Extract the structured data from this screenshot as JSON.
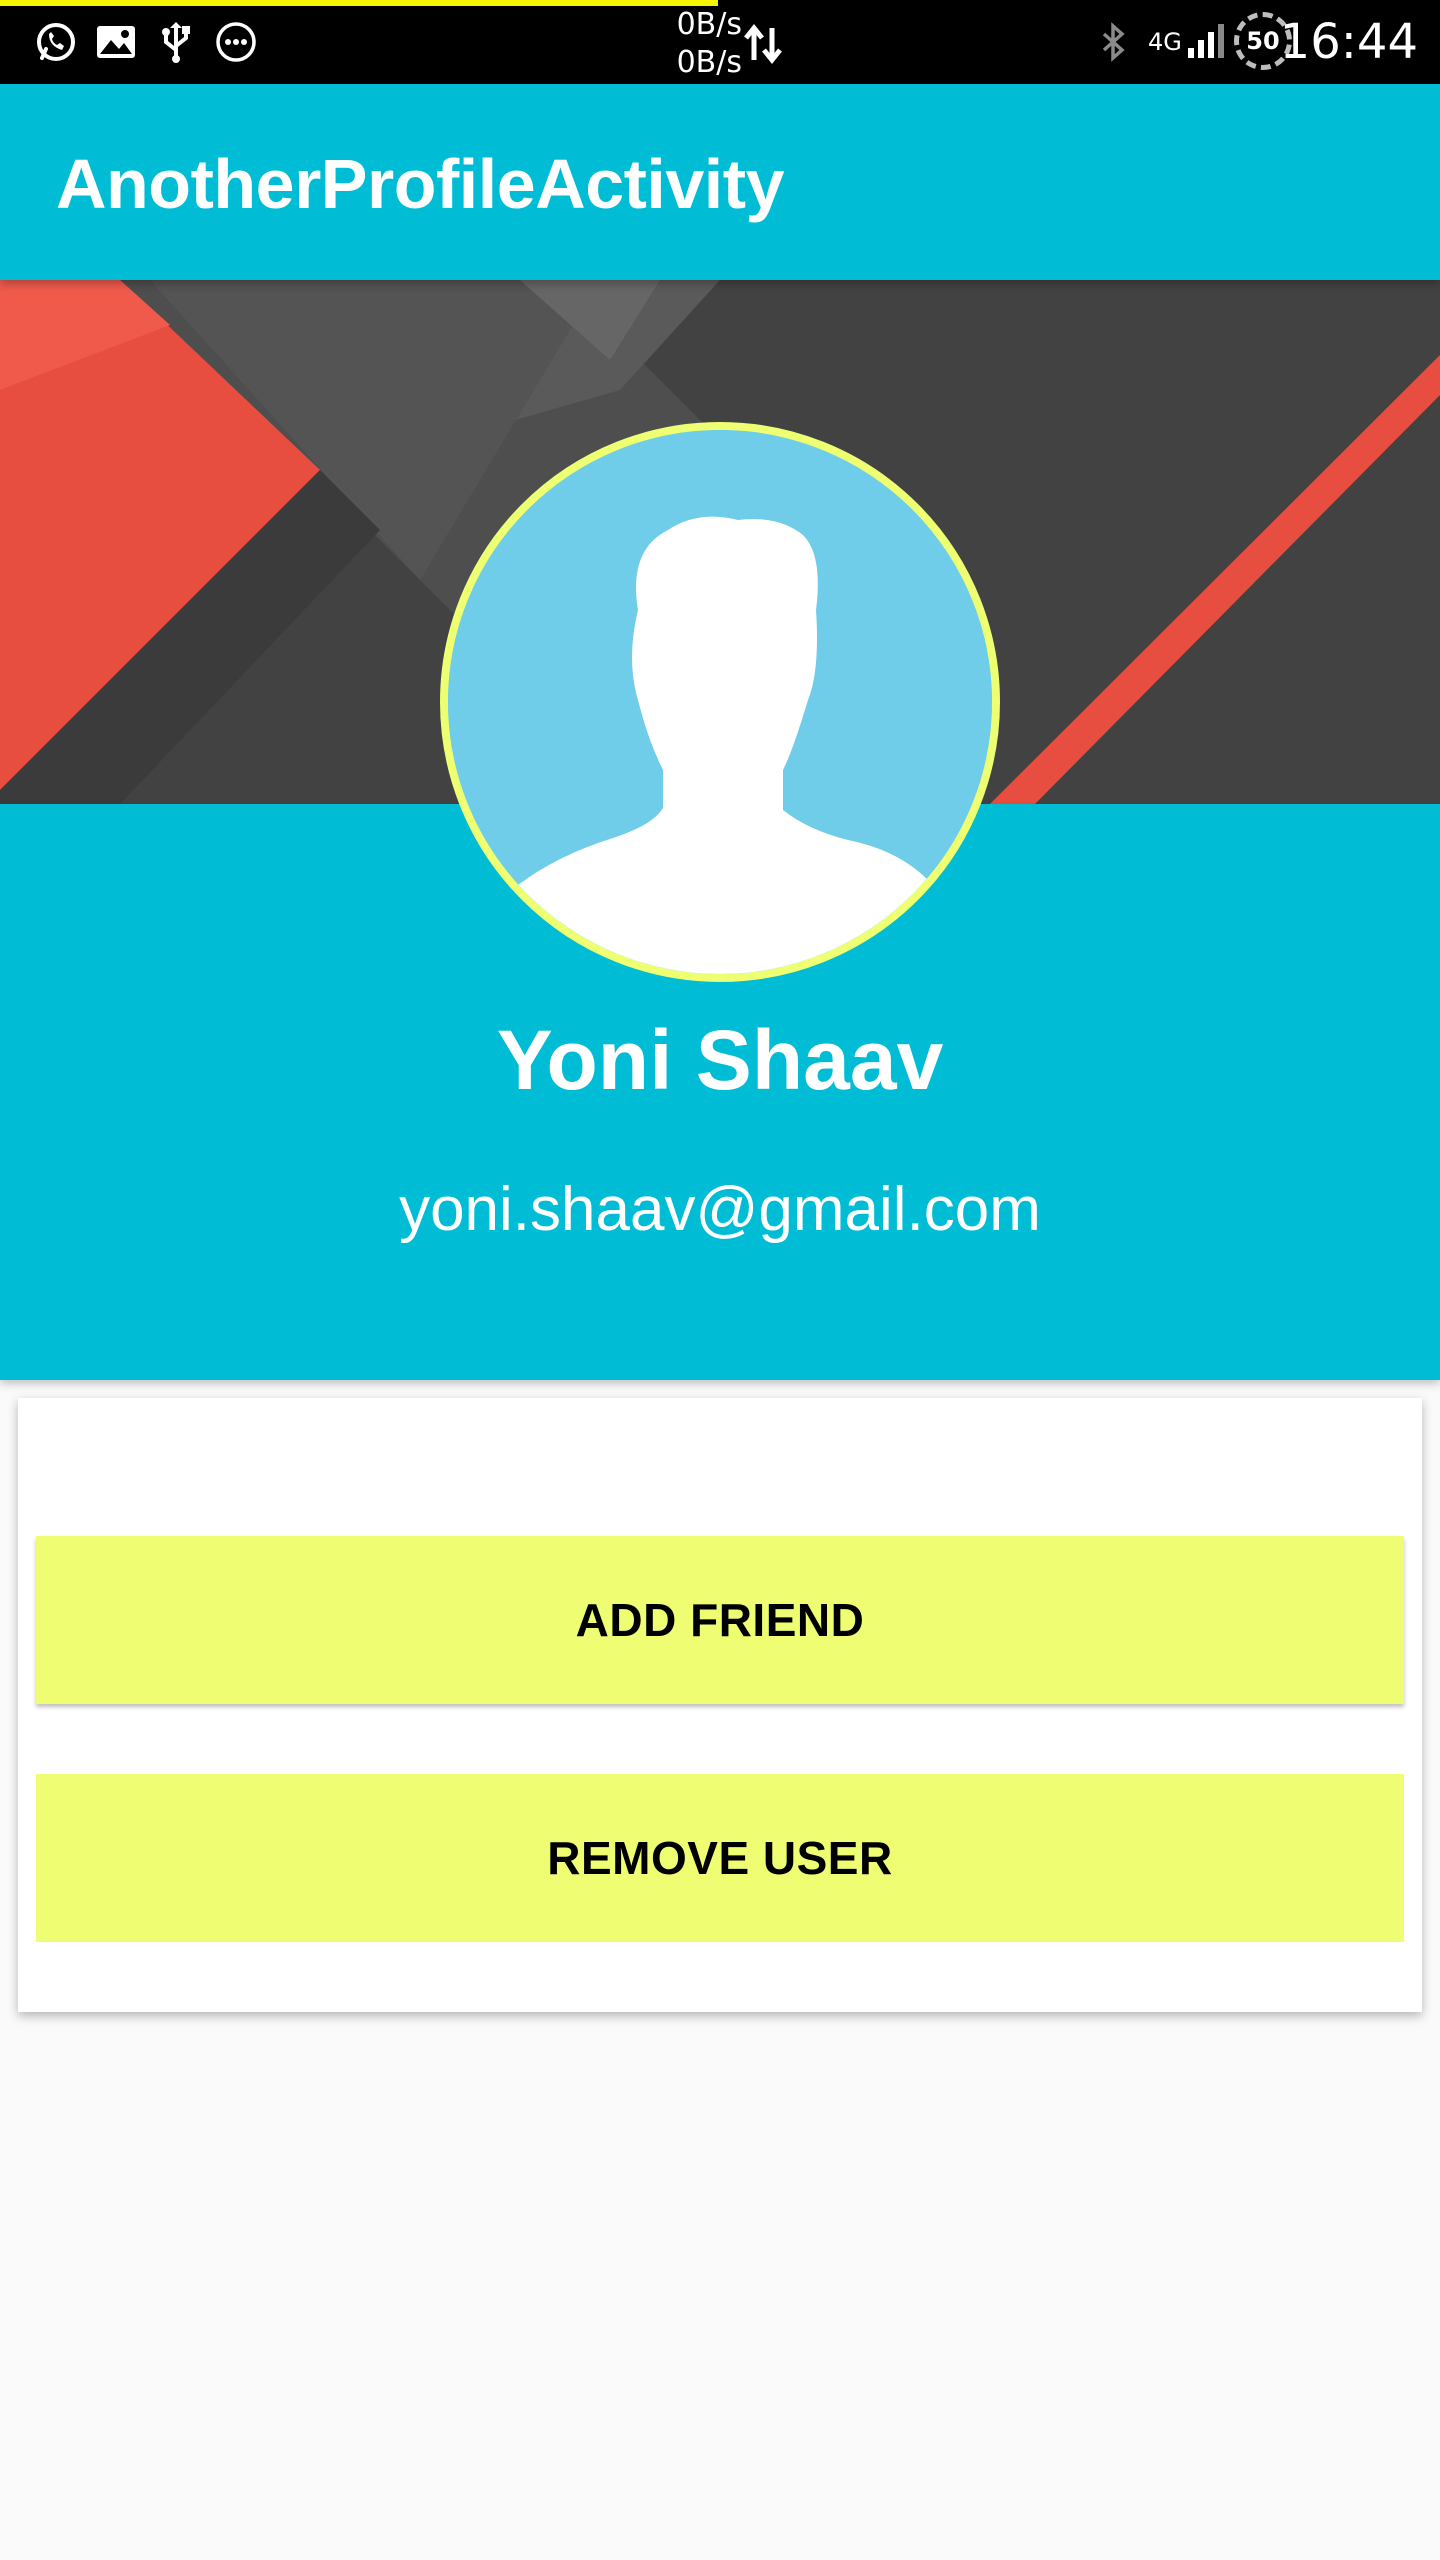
{
  "status_bar": {
    "time": "16:44",
    "upload_speed": "0B/s",
    "download_speed": "0B/s",
    "network_type": "4G",
    "battery_level": "50",
    "notification_icons": [
      "whatsapp-icon",
      "gallery-icon",
      "usb-icon",
      "more-notifications-icon"
    ],
    "system_icons": [
      "data-transfer-icon",
      "bluetooth-icon",
      "signal-icon",
      "battery-icon"
    ]
  },
  "app_bar": {
    "title": "AnotherProfileActivity"
  },
  "profile": {
    "name": "Yoni Shaav",
    "email": "yoni.shaav@gmail.com"
  },
  "actions": {
    "add_friend_label": "ADD FRIEND",
    "remove_user_label": "REMOVE USER"
  },
  "colors": {
    "primary": "#00bcd4",
    "accent": "#eefd72",
    "avatar_background": "#6fcde9",
    "header_red": "#e84e40",
    "header_dark": "#424242"
  }
}
